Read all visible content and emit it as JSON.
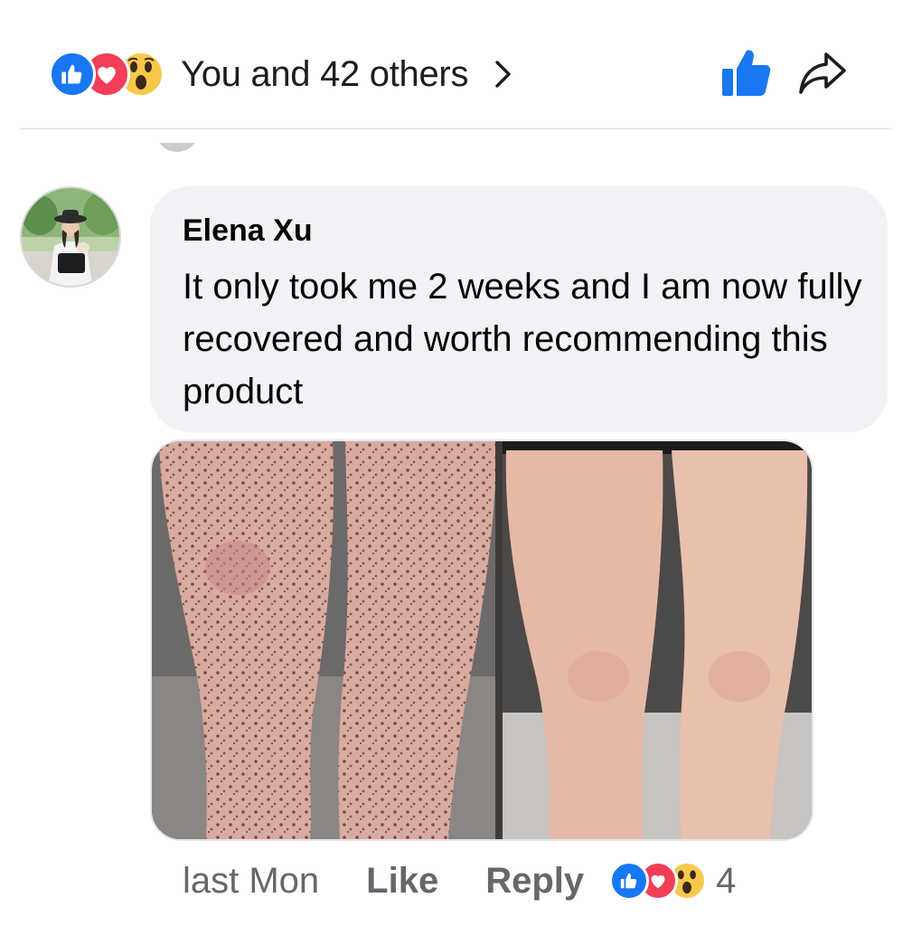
{
  "reactions_summary": {
    "text": "You and 42 others",
    "types": [
      "like-icon",
      "love-icon",
      "wow-icon"
    ]
  },
  "comment": {
    "author": "Elena Xu",
    "text": "It only took me 2 weeks and I am now fully recovered and worth recommending this product",
    "timestamp": "last Mon",
    "like_label": "Like",
    "reply_label": "Reply",
    "reaction_count": "4",
    "reaction_types": [
      "like-icon",
      "love-icon",
      "wow-icon"
    ]
  },
  "colors": {
    "brand_blue": "#1877f2",
    "love_red": "#f33e58",
    "wow_yellow": "#f7c84b",
    "bubble_bg": "#f0f2f5",
    "secondary_text": "#65676b"
  }
}
